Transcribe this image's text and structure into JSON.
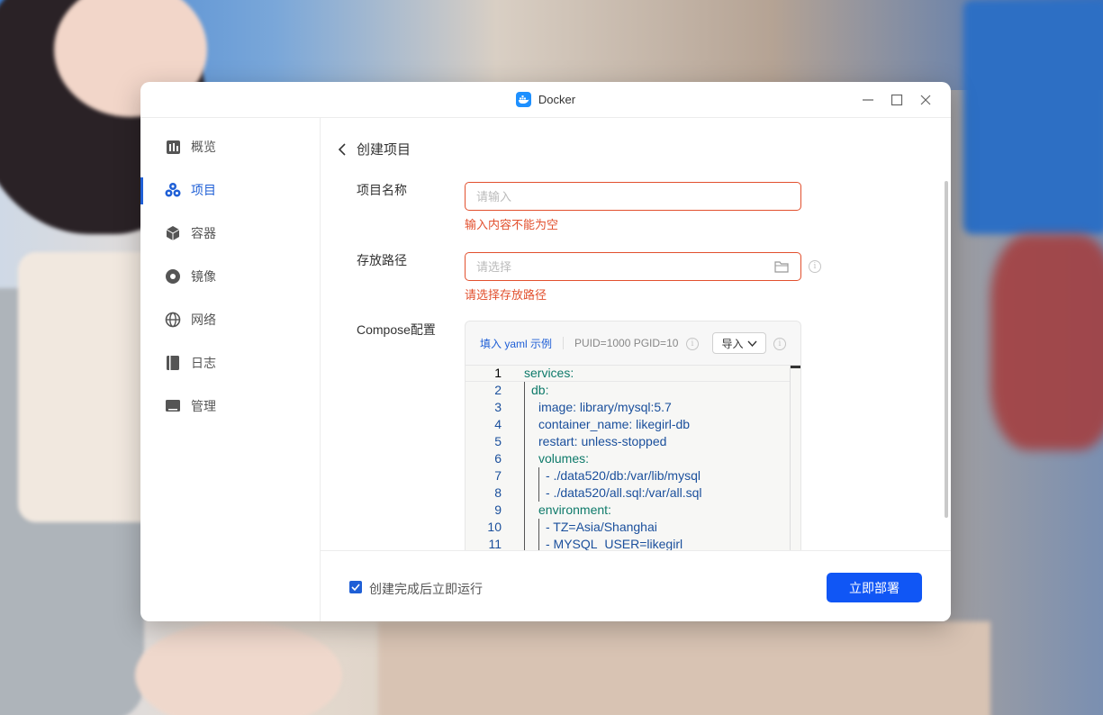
{
  "window": {
    "title": "Docker"
  },
  "sidebar": {
    "items": [
      {
        "label": "概览",
        "icon": "overview-icon",
        "active": false
      },
      {
        "label": "项目",
        "icon": "project-icon",
        "active": true
      },
      {
        "label": "容器",
        "icon": "container-icon",
        "active": false
      },
      {
        "label": "镜像",
        "icon": "image-icon",
        "active": false
      },
      {
        "label": "网络",
        "icon": "network-icon",
        "active": false
      },
      {
        "label": "日志",
        "icon": "log-icon",
        "active": false
      },
      {
        "label": "管理",
        "icon": "manage-icon",
        "active": false
      }
    ]
  },
  "main": {
    "page_title": "创建项目",
    "project_name": {
      "label": "项目名称",
      "placeholder": "请输入",
      "value": "",
      "error": "输入内容不能为空"
    },
    "storage_path": {
      "label": "存放路径",
      "placeholder": "请选择",
      "value": "",
      "error": "请选择存放路径"
    },
    "compose": {
      "label": "Compose配置",
      "fill_example": "填入 yaml 示例",
      "env_hint": "PUID=1000 PGID=10",
      "import_label": "导入",
      "lines": [
        {
          "n": "1",
          "text": "services:"
        },
        {
          "n": "2",
          "text": "db:"
        },
        {
          "n": "3",
          "text": "image: library/mysql:5.7"
        },
        {
          "n": "4",
          "text": "container_name: likegirl-db"
        },
        {
          "n": "5",
          "text": "restart: unless-stopped"
        },
        {
          "n": "6",
          "text": "volumes:"
        },
        {
          "n": "7",
          "text": "- ./data520/db:/var/lib/mysql"
        },
        {
          "n": "8",
          "text": "- ./data520/all.sql:/var/all.sql"
        },
        {
          "n": "9",
          "text": "environment:"
        },
        {
          "n": "10",
          "text": "- TZ=Asia/Shanghai"
        },
        {
          "n": "11",
          "text": "- MYSQL_USER=likegirl"
        }
      ]
    }
  },
  "footer": {
    "run_after_create": {
      "label": "创建完成后立即运行",
      "checked": true
    },
    "deploy_label": "立即部署"
  },
  "colors": {
    "accent": "#1f5fd6",
    "button": "#1056f5",
    "error": "#e2502e",
    "yaml_key": "#0e7a6a",
    "yaml_value": "#1a4f9c"
  }
}
